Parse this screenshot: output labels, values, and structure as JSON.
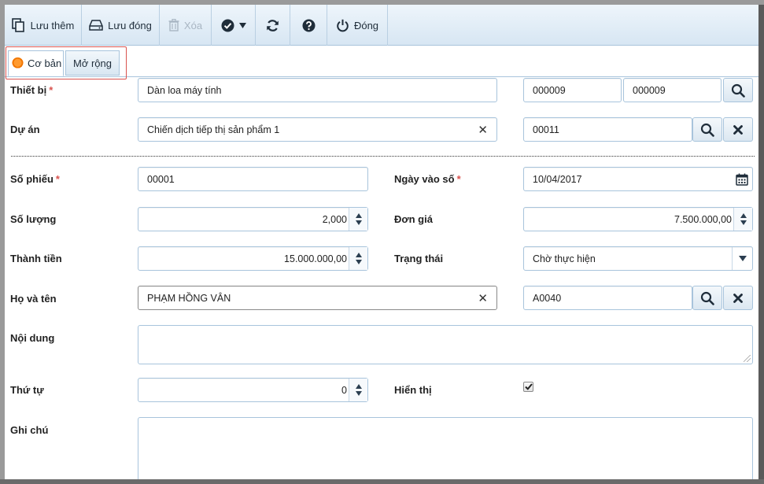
{
  "toolbar": {
    "save_add": "Lưu thêm",
    "save_close": "Lưu đóng",
    "delete": "Xóa",
    "close": "Đóng"
  },
  "tabs": {
    "basic": "Cơ bản",
    "extended": "Mở rộng"
  },
  "form": {
    "device": {
      "label": "Thiết bị",
      "value": "Dàn loa máy tính",
      "code1": "000009",
      "code2": "000009"
    },
    "project": {
      "label": "Dự án",
      "value": "Chiến dịch tiếp thị sản phẩm 1",
      "code": "00011"
    },
    "voucher_no": {
      "label": "Số phiếu",
      "value": "00001"
    },
    "entry_date": {
      "label": "Ngày vào số",
      "value": "10/04/2017"
    },
    "quantity": {
      "label": "Số lượng",
      "value": "2,000"
    },
    "unit_price": {
      "label": "Đơn giá",
      "value": "7.500.000,00"
    },
    "amount": {
      "label": "Thành tiền",
      "value": "15.000.000,00"
    },
    "status": {
      "label": "Trạng thái",
      "value": "Chờ thực hiện"
    },
    "full_name": {
      "label": "Họ và tên",
      "value": "PHẠM HỒNG VÂN",
      "code": "A0040"
    },
    "content": {
      "label": "Nội dung",
      "value": ""
    },
    "order": {
      "label": "Thứ tự",
      "value": "0"
    },
    "visible": {
      "label": "Hiển thị",
      "checked": true
    },
    "note": {
      "label": "Ghi chú",
      "value": ""
    },
    "required_mark": "*"
  },
  "colors": {
    "toolbar_top": "#eef5fb",
    "toolbar_bottom": "#d7e6f3",
    "border": "#a8c4dc",
    "required": "#d9534f",
    "tab_highlight": "#d9534f",
    "radio_orange": "#f17500"
  }
}
